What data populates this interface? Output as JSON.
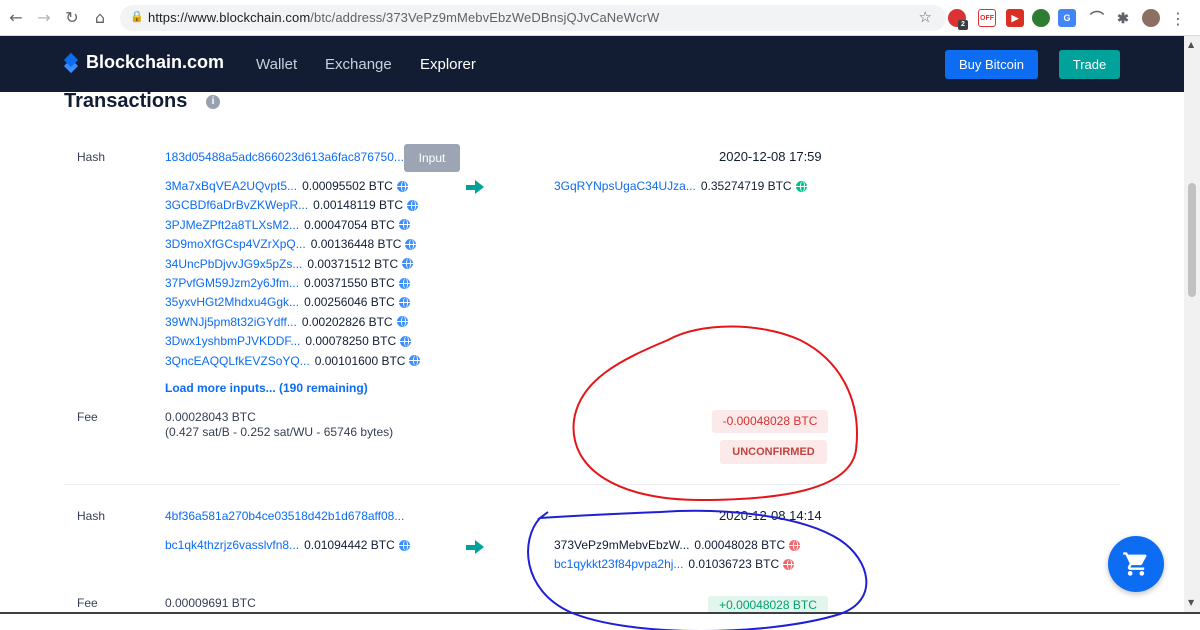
{
  "browser": {
    "url_host": "https://www.blockchain.com",
    "url_path": "/btc/address/373VePz9mMebvEbzWeDBnsjQJvCaNeWcrW",
    "ext_badge": "2",
    "ext_label": "OFF"
  },
  "header": {
    "logo": "Blockchain.com",
    "nav": [
      "Wallet",
      "Exchange",
      "Explorer"
    ],
    "buy_label": "Buy Bitcoin",
    "trade_label": "Trade"
  },
  "section": {
    "title": "Transactions"
  },
  "tx1": {
    "hash_label": "Hash",
    "hash": "183d05488a5adc866023d613a6fac876750...",
    "tooltip": "Input",
    "date": "2020-12-08 17:59",
    "inputs": [
      {
        "addr": "3Ma7xBqVEA2UQvpt5...",
        "amt": "0.00095502 BTC"
      },
      {
        "addr": "3GCBDf6aDrBvZKWepR...",
        "amt": "0.00148119 BTC"
      },
      {
        "addr": "3PJMeZPft2a8TLXsM2...",
        "amt": "0.00047054 BTC"
      },
      {
        "addr": "3D9moXfGCsp4VZrXpQ...",
        "amt": "0.00136448 BTC"
      },
      {
        "addr": "34UncPbDjvvJG9x5pZs...",
        "amt": "0.00371512 BTC"
      },
      {
        "addr": "37PvfGM59Jzm2y6Jfm...",
        "amt": "0.00371550 BTC"
      },
      {
        "addr": "35yxvHGt2Mhdxu4Ggk...",
        "amt": "0.00256046 BTC"
      },
      {
        "addr": "39WNJj5pm8t32iGYdff...",
        "amt": "0.00202826 BTC"
      },
      {
        "addr": "3Dwx1yshbmPJVKDDF...",
        "amt": "0.00078250 BTC"
      },
      {
        "addr": "3QncEAQQLfkEVZSoYQ...",
        "amt": "0.00101600 BTC"
      }
    ],
    "output": {
      "addr": "3GqRYNpsUgaC34UJza...",
      "amt": "0.35274719 BTC"
    },
    "load_more": "Load more inputs... (190 remaining)",
    "fee_label": "Fee",
    "fee": "0.00028043 BTC",
    "fee_detail": "(0.427 sat/B - 0.252 sat/WU - 65746 bytes)",
    "net": "-0.00048028 BTC",
    "status": "UNCONFIRMED"
  },
  "tx2": {
    "hash_label": "Hash",
    "hash": "4bf36a581a270b4ce03518d42b1d678aff08...",
    "date": "2020-12-08 14:14",
    "input": {
      "addr": "bc1qk4thzrjz6vasslvfn8...",
      "amt": "0.01094442 BTC"
    },
    "outputs": [
      {
        "addr": "373VePz9mMebvEbzW...",
        "amt": "0.00048028 BTC"
      },
      {
        "addr": "bc1qykkt23f84pvpa2hj...",
        "amt": "0.01036723 BTC"
      }
    ],
    "fee_label": "Fee",
    "fee": "0.00009691 BTC",
    "net": "+0.00048028 BTC"
  },
  "colors": {
    "brand_dark": "#121d33",
    "brand_blue": "#0c6cf2",
    "teal": "#00a29b",
    "annot_red": "#e4161b",
    "annot_blue": "#1f1fd6"
  }
}
